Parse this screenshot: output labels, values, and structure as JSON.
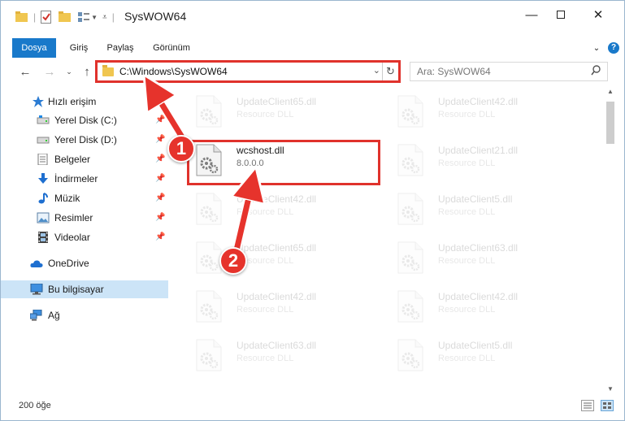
{
  "window": {
    "title": "SysWOW64"
  },
  "ribbon": {
    "tabs": [
      "Dosya",
      "Giriş",
      "Paylaş",
      "Görünüm"
    ]
  },
  "address": {
    "path": "C:\\Windows\\SysWOW64"
  },
  "search": {
    "placeholder": "Ara: SysWOW64"
  },
  "navpane": {
    "items": [
      {
        "label": "Hızlı erişim",
        "icon": "star-icon",
        "pinned": false
      },
      {
        "label": "Yerel Disk (C:)",
        "icon": "drive-icon",
        "pinned": true
      },
      {
        "label": "Yerel Disk (D:)",
        "icon": "drive-icon",
        "pinned": true
      },
      {
        "label": "Belgeler",
        "icon": "document-icon",
        "pinned": true
      },
      {
        "label": "İndirmeler",
        "icon": "download-icon",
        "pinned": true
      },
      {
        "label": "Müzik",
        "icon": "music-icon",
        "pinned": true
      },
      {
        "label": "Resimler",
        "icon": "pictures-icon",
        "pinned": true
      },
      {
        "label": "Videolar",
        "icon": "video-icon",
        "pinned": true
      },
      {
        "label": "OneDrive",
        "icon": "cloud-icon",
        "pinned": false
      },
      {
        "label": "Bu bilgisayar",
        "icon": "computer-icon",
        "pinned": false,
        "selected": true
      },
      {
        "label": "Ağ",
        "icon": "network-icon",
        "pinned": false
      }
    ]
  },
  "files": [
    {
      "name": "UpdateClient65.dll",
      "type": "Resource DLL"
    },
    {
      "name": "UpdateClient42.dll",
      "type": "Resource DLL"
    },
    {
      "name": "wcshost.dll",
      "type": "8.0.0.0",
      "highlighted": true
    },
    {
      "name": "UpdateClient21.dll",
      "type": "Resource DLL"
    },
    {
      "name": "UpdateClient42.dll",
      "type": "Resource DLL"
    },
    {
      "name": "UpdateClient5.dll",
      "type": "Resource DLL"
    },
    {
      "name": "UpdateClient65.dll",
      "type": "Resource DLL"
    },
    {
      "name": "UpdateClient63.dll",
      "type": "Resource DLL"
    },
    {
      "name": "UpdateClient42.dll",
      "type": "Resource DLL"
    },
    {
      "name": "UpdateClient42.dll",
      "type": "Resource DLL"
    },
    {
      "name": "UpdateClient63.dll",
      "type": "Resource DLL"
    },
    {
      "name": "UpdateClient5.dll",
      "type": "Resource DLL"
    }
  ],
  "status": {
    "count": "200 öğe"
  },
  "annotations": {
    "step1": "1",
    "step2": "2"
  },
  "colors": {
    "accent": "#1979ca",
    "highlight": "#e0322c",
    "selected": "#cce4f7"
  }
}
